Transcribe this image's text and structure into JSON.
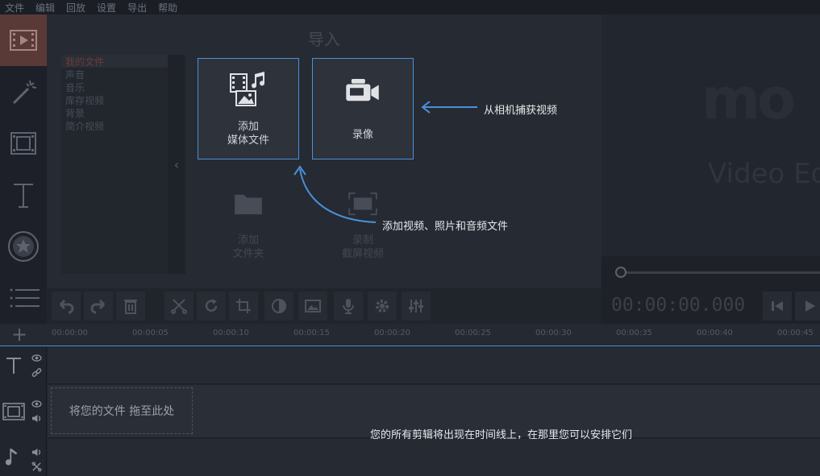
{
  "menu": [
    "文件",
    "编辑",
    "回放",
    "设置",
    "导出",
    "帮助"
  ],
  "import_panel": {
    "title": "导入",
    "categories": [
      "我的文件",
      "声音",
      "音乐",
      "库存视频",
      "背景",
      "简介视频"
    ],
    "collapse_glyph": "‹",
    "tiles": {
      "add_media": "添加\n媒体文件",
      "record_video": "录像",
      "add_folder": "添加\n文件夹",
      "record_screen": "录制\n截屏视频"
    }
  },
  "hints": {
    "camera": "从相机捕获视频",
    "media": "添加视频、照片和音频文件",
    "timeline": "您的所有剪辑将出现在时间线上，在那里您可以安排它们"
  },
  "preview": {
    "logo_text": "mo",
    "product_text": "Video Ed",
    "timecode": "00:00:00.000"
  },
  "timeline": {
    "ticks": [
      "00:00:00",
      "00:00:05",
      "00:00:10",
      "00:00:15",
      "00:00:20",
      "00:00:25",
      "00:00:30",
      "00:00:35",
      "00:00:40",
      "00:00:45"
    ],
    "dropzone": "将您的文件 拖至此处",
    "add_track_glyph": "+"
  },
  "colors": {
    "accent": "#4a90d9",
    "active_tool": "#5a3a36"
  }
}
